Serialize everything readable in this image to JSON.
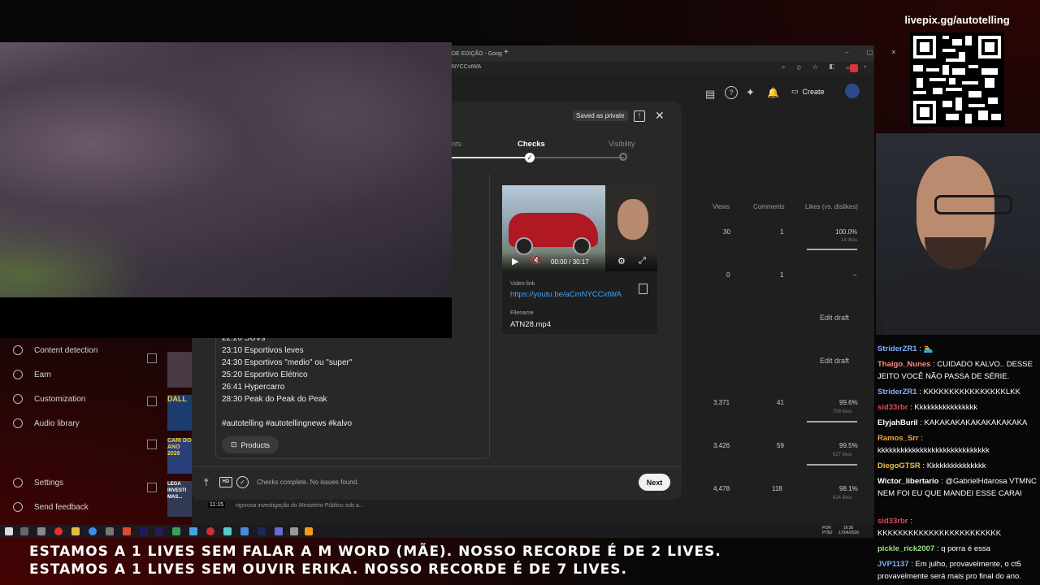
{
  "browser": {
    "tab_title": "DE EDIÇÃO - Goog",
    "url_fragment": "NYCCxtWA",
    "new_tab": "+"
  },
  "studio": {
    "create_label": "Create",
    "sidebar": [
      {
        "icon": "copyright-icon",
        "label": "Content detection"
      },
      {
        "icon": "dollar-icon",
        "label": "Earn"
      },
      {
        "icon": "wand-icon",
        "label": "Customization"
      },
      {
        "icon": "audio-library-icon",
        "label": "Audio library"
      },
      {
        "icon": "gear-icon",
        "label": "Settings"
      },
      {
        "icon": "feedback-icon",
        "label": "Send feedback"
      }
    ],
    "columns": {
      "views": "Views",
      "comments": "Comments",
      "likes": "Likes (vs. dislikes)"
    },
    "rows": [
      {
        "views": "30",
        "comments": "1",
        "likes": "100.0%",
        "likes_sub": "14 likes",
        "like_fraction": 1.0
      },
      {
        "views": "0",
        "comments": "1",
        "likes": "–",
        "likes_sub": "",
        "like_fraction": 0
      },
      {
        "edit_draft": "Edit draft"
      },
      {
        "edit_draft": "Edit draft"
      },
      {
        "views": "3,371",
        "comments": "41",
        "likes": "99.6%",
        "likes_sub": "709 likes",
        "like_fraction": 0.996
      },
      {
        "views": "3,426",
        "comments": "59",
        "likes": "99.5%",
        "likes_sub": "627 likes",
        "like_fraction": 0.995
      },
      {
        "views": "4,478",
        "comments": "118",
        "likes": "98.1%",
        "likes_sub": "824 likes",
        "like_fraction": 0.981
      }
    ],
    "thumb_texts": [
      "DALL",
      "CARI DO ANO 2026",
      "LEGA INVESTI MAS..."
    ],
    "thumb_duration": "11:15",
    "row_desc": "rigorosa investigação do Ministério Público sob a..."
  },
  "modal": {
    "saved_badge": "Saved as private",
    "steps": [
      {
        "label": "nts"
      },
      {
        "label": "Checks"
      },
      {
        "label": "Visibility"
      }
    ],
    "description_lines": [
      "22:20 SUVs",
      "23:10 Esportivos leves",
      "24:30 Esportivos \"medio\" ou \"super\"",
      "25:20 Esportivo Elétrico",
      "26:41 Hypercarro",
      "28:30 Peak do Peak do Peak",
      "",
      "#autotelling #autotellingnews #kalvo"
    ],
    "products_label": "Products",
    "player_time": "00:00 / 30:17",
    "video_link_label": "Video link",
    "video_link": "https://youtu.be/aCmNYCCxtWA",
    "filename_label": "Filename",
    "filename": "ATN28.mp4",
    "status_text": "Checks complete. No issues found.",
    "next_label": "Next"
  },
  "taskbar": {
    "lang": "POR PTB2",
    "time": "19:36",
    "date": "17/04/2026"
  },
  "stream": {
    "livepix": "livepix.gg/autotelling",
    "chat": [
      {
        "user": "StriderZR1",
        "color": "#7fb0ff",
        "text": "🏊"
      },
      {
        "user": "Thaigo_Nunes",
        "color": "#ff8a80",
        "text": "CUIDADO KALVO.. DESSE JEITO VOCÊ NÃO PASSA DE SÉRIE."
      },
      {
        "user": "StriderZR1",
        "color": "#7fb0ff",
        "text": "KKKKKKKKKKKKKKKKLKK"
      },
      {
        "user": "sid33rbr",
        "color": "#e0455a",
        "text": "Kkkkkkkkkkkkkkkk"
      },
      {
        "user": "ElyjahBuril",
        "color": "#ffffff",
        "text": "KAKAKAKAKAKAKAKAKAKA"
      },
      {
        "user": "Ramos_Srr",
        "color": "#f0a640",
        "text": "kkkkkkkkkkkkkkkkkkkkkkkkkkkkk"
      },
      {
        "user": "DiegoGTSR",
        "color": "#f0c040",
        "text": "Kkkkkkkkkkkkkkk"
      },
      {
        "user": "Wictor_libertario",
        "color": "#ffffff",
        "text": "@GabrielHdarosa VTMNC NEM FOI EU QUE MANDEI ESSE CARAI",
        "mention": "@GabrielHdarosa"
      },
      {
        "user": "sid33rbr",
        "color": "#e0455a",
        "text": "KKKKKKKKKKKKKKKKKKKKKKKK"
      },
      {
        "user": "pickle_rick2007",
        "color": "#9be08a",
        "text": "q porra é essa"
      },
      {
        "user": "JVP1137",
        "color": "#7fb0ff",
        "text": "Em julho, provavelmente, o ct5 provavelmente será mais pro final do ano."
      }
    ],
    "ticker_line1": "ESTAMOS A 1 LIVES SEM FALAR A M WORD (MÃE). NOSSO RECORDE É DE 2 LIVES.",
    "ticker_line2": "ESTAMOS A 1 LIVES SEM OUVIR ERIKA. NOSSO RECORDE É DE 7 LIVES."
  }
}
